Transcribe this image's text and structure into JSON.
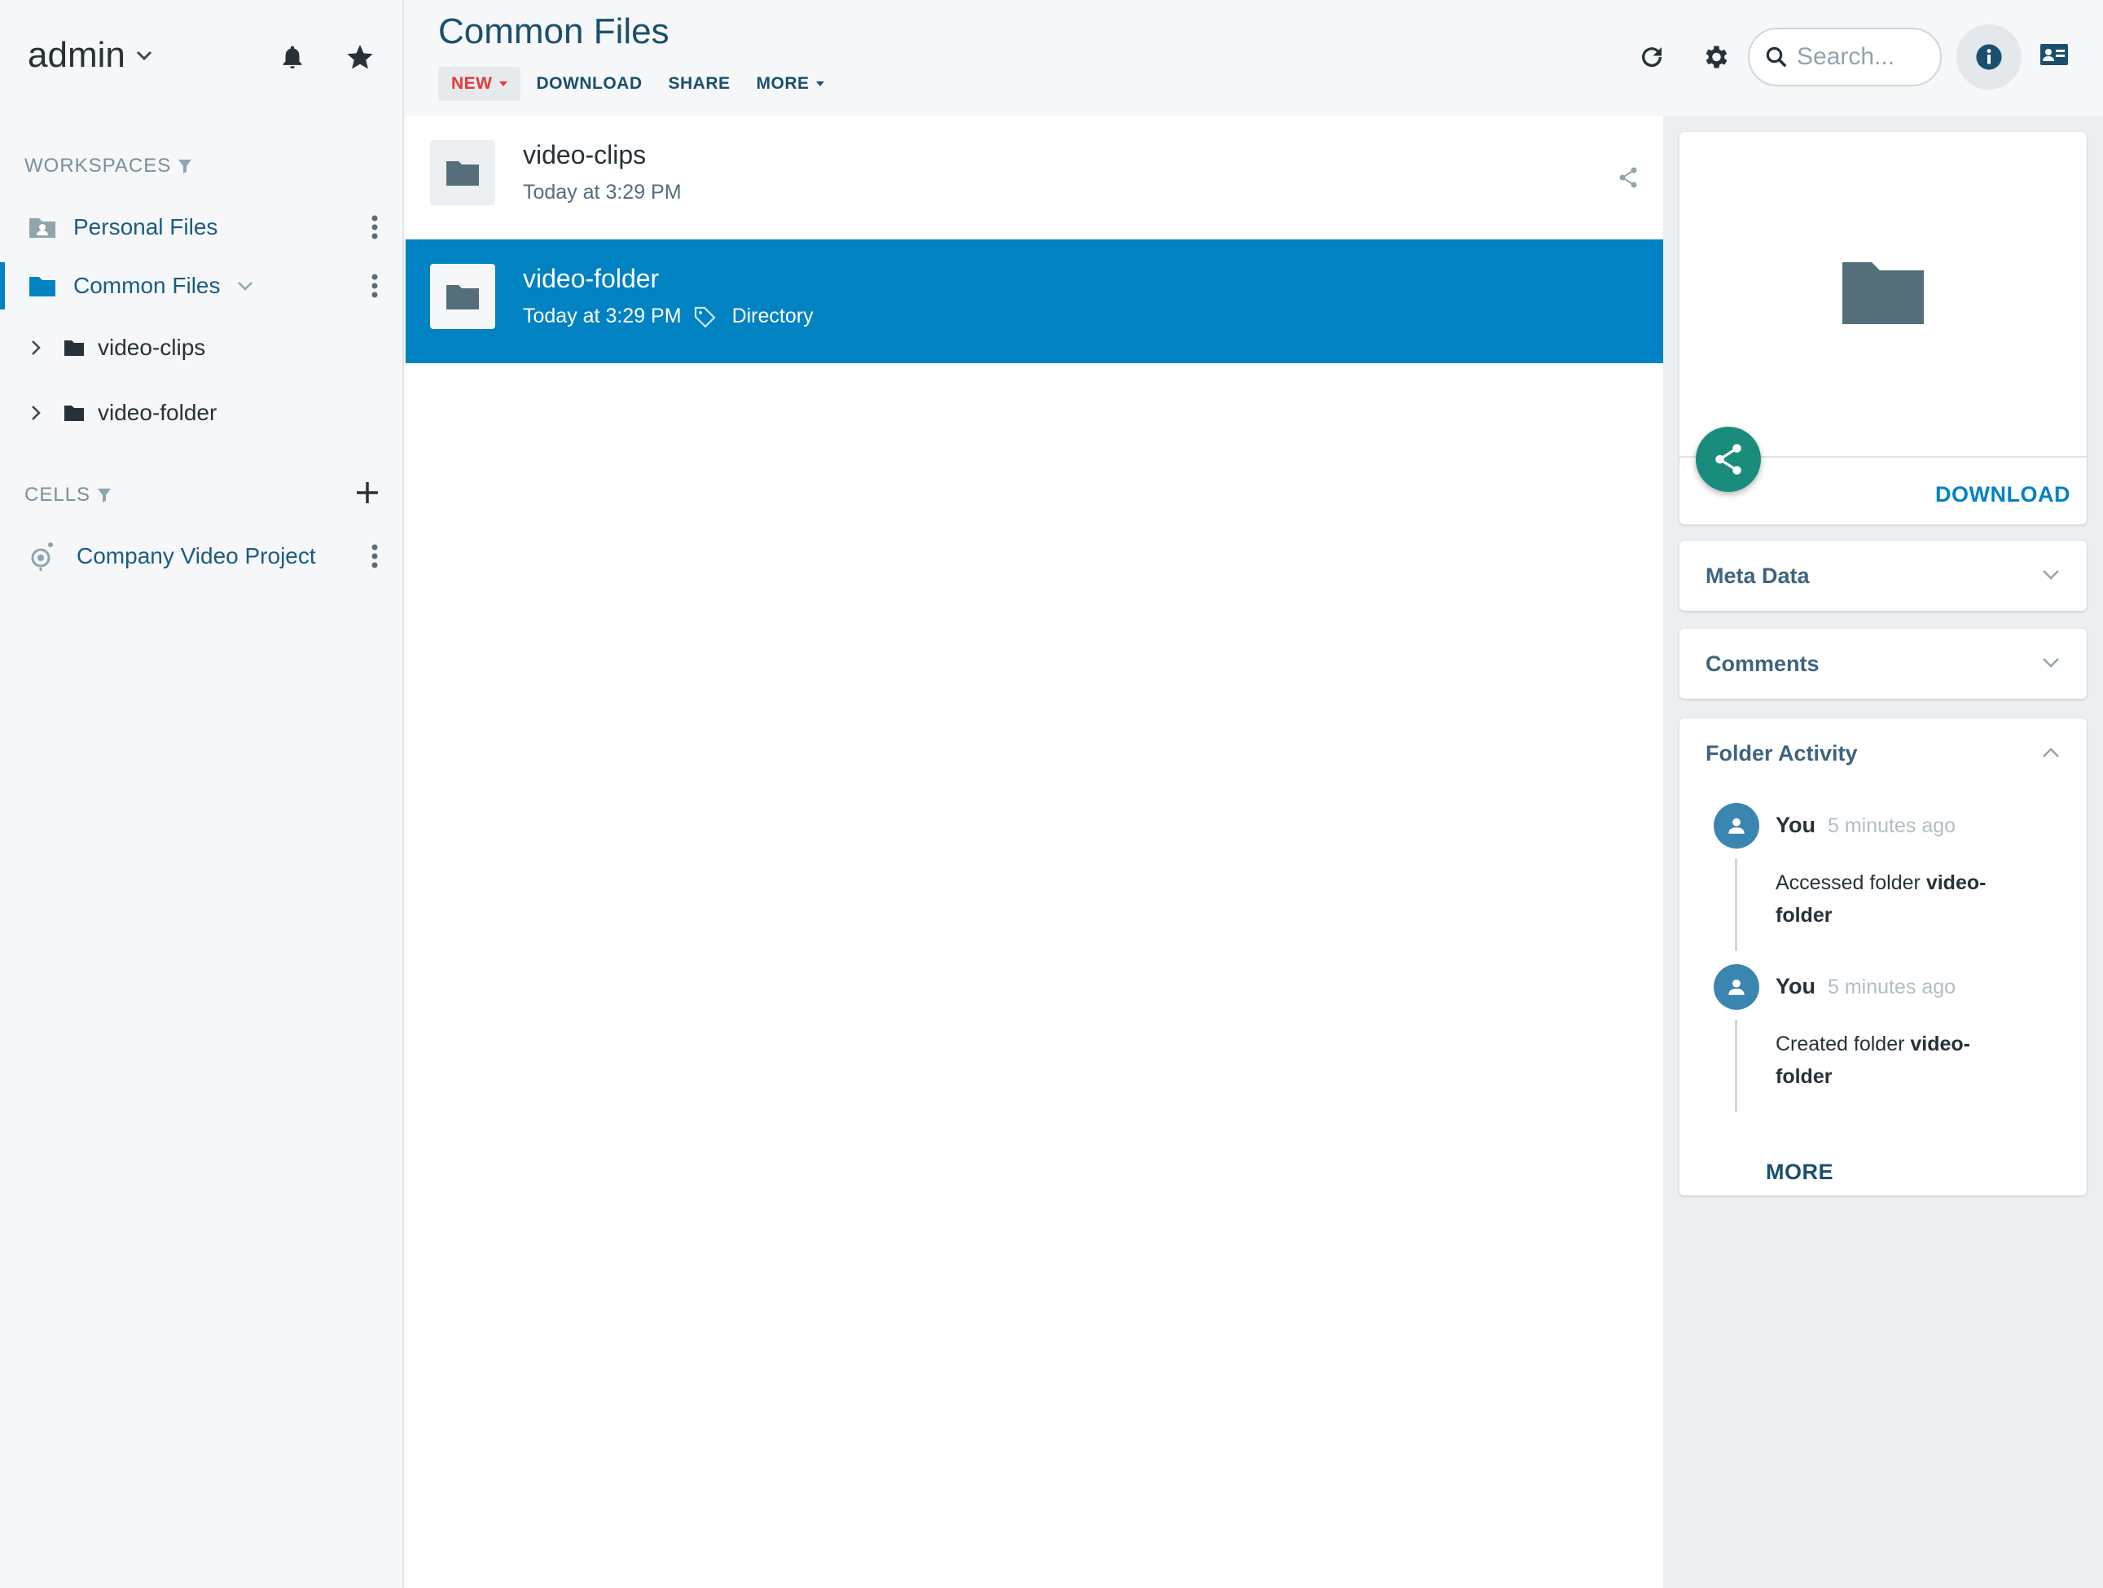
{
  "user": {
    "name": "admin"
  },
  "sidebar": {
    "workspaces_title": "WORKSPACES",
    "workspaces": [
      {
        "label": "Personal Files"
      },
      {
        "label": "Common Files"
      }
    ],
    "tree": [
      {
        "label": "video-clips"
      },
      {
        "label": "video-folder"
      }
    ],
    "cells_title": "CELLS",
    "cells": [
      {
        "label": "Company Video Project"
      }
    ]
  },
  "header": {
    "title": "Common Files",
    "toolbar": {
      "new_label": "NEW",
      "download_label": "DOWNLOAD",
      "share_label": "SHARE",
      "more_label": "MORE"
    },
    "search": {
      "placeholder": "Search..."
    }
  },
  "files": [
    {
      "name": "video-clips",
      "modified": "Today at 3:29 PM",
      "type": "",
      "selected": false
    },
    {
      "name": "video-folder",
      "modified": "Today at 3:29 PM",
      "type": "Directory",
      "selected": true
    }
  ],
  "details": {
    "download_label": "DOWNLOAD",
    "meta_title": "Meta Data",
    "comments_title": "Comments",
    "activity_title": "Folder Activity",
    "activity": [
      {
        "user": "You",
        "time": "5 minutes ago",
        "action": "Accessed folder ",
        "target": "video-folder"
      },
      {
        "user": "You",
        "time": "5 minutes ago",
        "action": "Created folder ",
        "target": "video-folder"
      }
    ],
    "more_label": "MORE"
  },
  "colors": {
    "accent": "#0082c3",
    "new_red": "#e53935",
    "fab_green": "#1a8c7b",
    "title_navy": "#1b4f6e"
  }
}
